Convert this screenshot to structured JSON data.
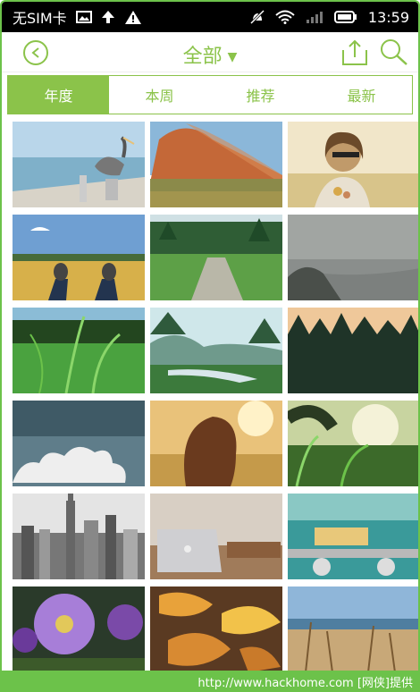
{
  "status_bar": {
    "carrier": "无SIM卡",
    "time": "13:59"
  },
  "header": {
    "title": "全部",
    "caret": "▼"
  },
  "tabs": [
    {
      "label": "年度",
      "active": true
    },
    {
      "label": "本周",
      "active": false
    },
    {
      "label": "推荐",
      "active": false
    },
    {
      "label": "最新",
      "active": false
    }
  ],
  "photos": [
    {
      "name": "pelican-pier"
    },
    {
      "name": "red-dune"
    },
    {
      "name": "girl-sunglasses"
    },
    {
      "name": "feet-wheat-field"
    },
    {
      "name": "forest-path"
    },
    {
      "name": "foggy-coast"
    },
    {
      "name": "tall-grass"
    },
    {
      "name": "misty-river-valley"
    },
    {
      "name": "dark-forest-sunset"
    },
    {
      "name": "cloud-sky"
    },
    {
      "name": "girl-hair-sunset"
    },
    {
      "name": "grass-sun-flare"
    },
    {
      "name": "city-skyline-bw"
    },
    {
      "name": "laptop-desk"
    },
    {
      "name": "vintage-car-plate"
    },
    {
      "name": "purple-flowers"
    },
    {
      "name": "autumn-leaves"
    },
    {
      "name": "dry-grass-sea"
    }
  ],
  "colors": {
    "accent": "#8bc34a",
    "frame": "#6cc24a"
  },
  "watermark": "http://www.hackhome.com [网侠]提供"
}
